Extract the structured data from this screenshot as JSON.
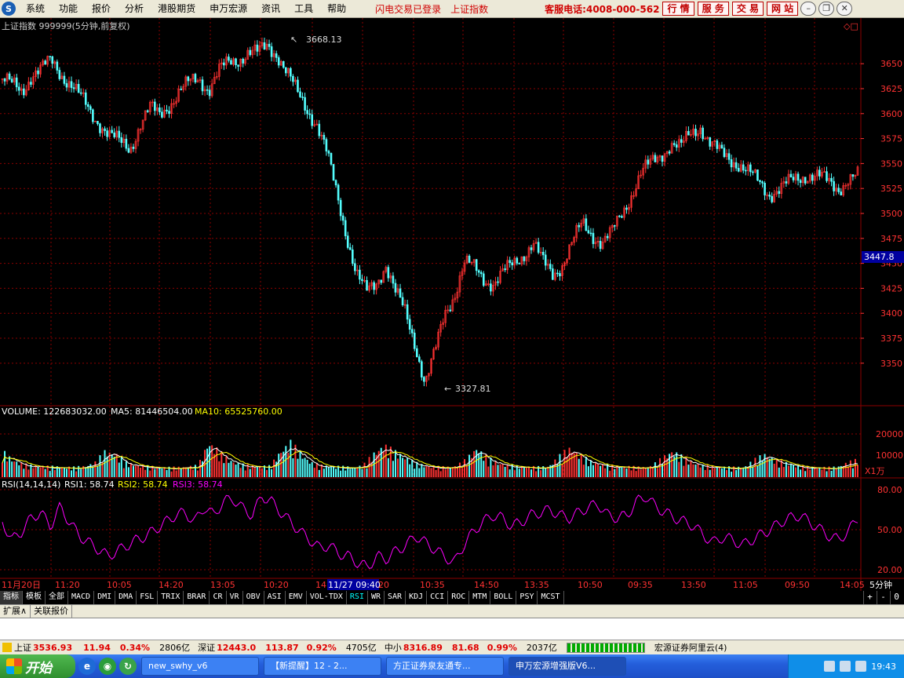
{
  "menu": {
    "items": [
      "系统",
      "功能",
      "报价",
      "分析",
      "港股期货",
      "申万宏源",
      "资讯",
      "工具",
      "帮助"
    ],
    "status": "闪电交易已登录",
    "index_name": "上证指数",
    "hotline": "客服电话:4008-000-562",
    "quick_buttons": [
      "行 情",
      "服 务",
      "交 易",
      "网 站"
    ]
  },
  "chart_header": {
    "title": "上证指数 999999(5分钟,前复权)"
  },
  "volume_header": {
    "volume_label": "VOLUME: 122683032.00",
    "ma5_label": "MA5: 81446504.00",
    "ma10_label": "MA10: 65525760.00"
  },
  "rsi_header": {
    "name": "RSI(14,14,14)",
    "rsi1": "RSI1: 58.74",
    "rsi2": "RSI2: 58.74",
    "rsi3": "RSI3: 58.74"
  },
  "price_axis": {
    "ticks": [
      "3650",
      "3625",
      "3600",
      "3575",
      "3550",
      "3525",
      "3500",
      "3475",
      "3450",
      "3425",
      "3400",
      "3375",
      "3350"
    ],
    "current": "3447.8",
    "high_label": "3668.13",
    "low_label": "3327.81"
  },
  "volume_axis": {
    "ticks": [
      "20000",
      "10000"
    ],
    "unit": "X1万"
  },
  "rsi_axis": {
    "ticks": [
      "80.00",
      "50.00",
      "20.00"
    ]
  },
  "time_axis": {
    "labels": [
      "11月20日",
      "11:20",
      "10:05",
      "14:20",
      "13:05",
      "10:20",
      "14",
      "11/27 09:40",
      "20",
      "10:35",
      "14:50",
      "13:35",
      "10:50",
      "09:35",
      "13:50",
      "11:05",
      "09:50",
      "14:05"
    ],
    "period": "5分钟"
  },
  "tabs": [
    "指标",
    "模板",
    "全部",
    "MACD",
    "DMI",
    "DMA",
    "FSL",
    "TRIX",
    "BRAR",
    "CR",
    "VR",
    "OBV",
    "ASI",
    "EMV",
    "VOL-TDX",
    "RSI",
    "WR",
    "SAR",
    "KDJ",
    "CCI",
    "ROC",
    "MTM",
    "BOLL",
    "PSY",
    "MCST"
  ],
  "tab_controls": [
    "+",
    "-",
    "0"
  ],
  "subtabs": [
    "扩展∧",
    "关联报价"
  ],
  "ticker": {
    "items": [
      {
        "name": "上证",
        "price": "3536.93",
        "change": "11.94",
        "pct": "0.34%",
        "amount": "2806亿"
      },
      {
        "name": "深证",
        "price": "12443.0",
        "change": "113.87",
        "pct": "0.92%",
        "amount": "4705亿"
      },
      {
        "name": "中小",
        "price": "8316.89",
        "change": "81.68",
        "pct": "0.99%",
        "amount": "2037亿"
      }
    ],
    "broker": "宏源证券阿里云(4)"
  },
  "taskbar": {
    "start": "开始",
    "tasks": [
      "new_swhy_v6",
      "【新提醒】12 - 2...",
      "方正证券泉友通专...",
      "申万宏源增强版V6..."
    ],
    "clock": "19:43"
  },
  "colors": {
    "up": "#ff3232",
    "down": "#54ffff",
    "grid": "#8b0000",
    "rsi": "#ff00ff",
    "ma5": "#ffffff",
    "ma10": "#ffff00"
  },
  "chart_data": {
    "type": "candlestick",
    "title": "上证指数 999999(5分钟,前复权)",
    "ylim": [
      3320,
      3680
    ],
    "high": 3668.13,
    "low": 3327.81,
    "last": 3447.8,
    "price_path": [
      3635,
      3628,
      3622,
      3640,
      3645,
      3652,
      3640,
      3630,
      3615,
      3600,
      3590,
      3578,
      3570,
      3565,
      3590,
      3605,
      3598,
      3610,
      3622,
      3630,
      3635,
      3625,
      3642,
      3650,
      3655,
      3662,
      3660,
      3668,
      3660,
      3640,
      3620,
      3605,
      3590,
      3560,
      3520,
      3480,
      3440,
      3420,
      3430,
      3450,
      3420,
      3400,
      3370,
      3330,
      3360,
      3400,
      3420,
      3450,
      3445,
      3435,
      3430,
      3440,
      3450,
      3460,
      3470,
      3450,
      3440,
      3450,
      3470,
      3490,
      3480,
      3470,
      3480,
      3500,
      3520,
      3540,
      3550,
      3560,
      3570,
      3565,
      3580,
      3588,
      3570,
      3560,
      3555,
      3550,
      3540,
      3530,
      3520,
      3525,
      3530,
      3535,
      3540,
      3538,
      3530,
      3525,
      3535,
      3537
    ],
    "volume_ylim": [
      0,
      26000
    ],
    "volume_base": [
      9000,
      6000,
      4500,
      4000,
      3800,
      3600,
      3500,
      3400,
      3800,
      5000,
      9000,
      8000,
      5000,
      4200,
      3800,
      3500,
      3300,
      3400,
      3600,
      4000,
      12000,
      9000,
      6000,
      4500,
      4000,
      3800,
      3800,
      9000,
      12000,
      8000,
      5000,
      4000,
      3800,
      3600,
      3400,
      4000,
      8000,
      11000,
      9000,
      7000,
      5000,
      4000,
      3600,
      3500,
      3800,
      6000,
      10000,
      7000,
      5000,
      4200,
      3800,
      3600,
      3500,
      3700,
      7000,
      10000,
      8000,
      5500,
      4500,
      4000,
      3800,
      3600,
      3400,
      3800,
      6500,
      9000,
      7000,
      5000,
      4000,
      3800,
      3500,
      3400,
      3500,
      6000,
      8000,
      6000,
      5000,
      4000,
      3600,
      3400,
      3300,
      3500,
      5000,
      6000
    ],
    "rsi_ylim": [
      15,
      85
    ],
    "rsi_path": [
      55,
      42,
      48,
      58,
      62,
      52,
      66,
      55,
      45,
      40,
      35,
      30,
      34,
      38,
      42,
      45,
      50,
      55,
      60,
      62,
      55,
      66,
      60,
      70,
      72,
      65,
      60,
      74,
      70,
      62,
      55,
      48,
      42,
      36,
      38,
      32,
      30,
      25,
      22,
      30,
      28,
      34,
      38,
      45,
      40,
      35,
      30,
      25,
      38,
      48,
      55,
      60,
      58,
      52,
      55,
      60,
      62,
      64,
      60,
      58,
      62,
      66,
      68,
      60,
      58,
      60,
      70,
      74,
      66,
      62,
      58,
      55,
      52,
      45,
      40,
      44,
      42,
      38,
      42,
      46,
      50,
      55,
      58,
      60,
      55,
      50,
      45,
      42,
      48,
      58
    ],
    "rsi1": 58.74,
    "rsi2": 58.74,
    "rsi3": 58.74
  }
}
